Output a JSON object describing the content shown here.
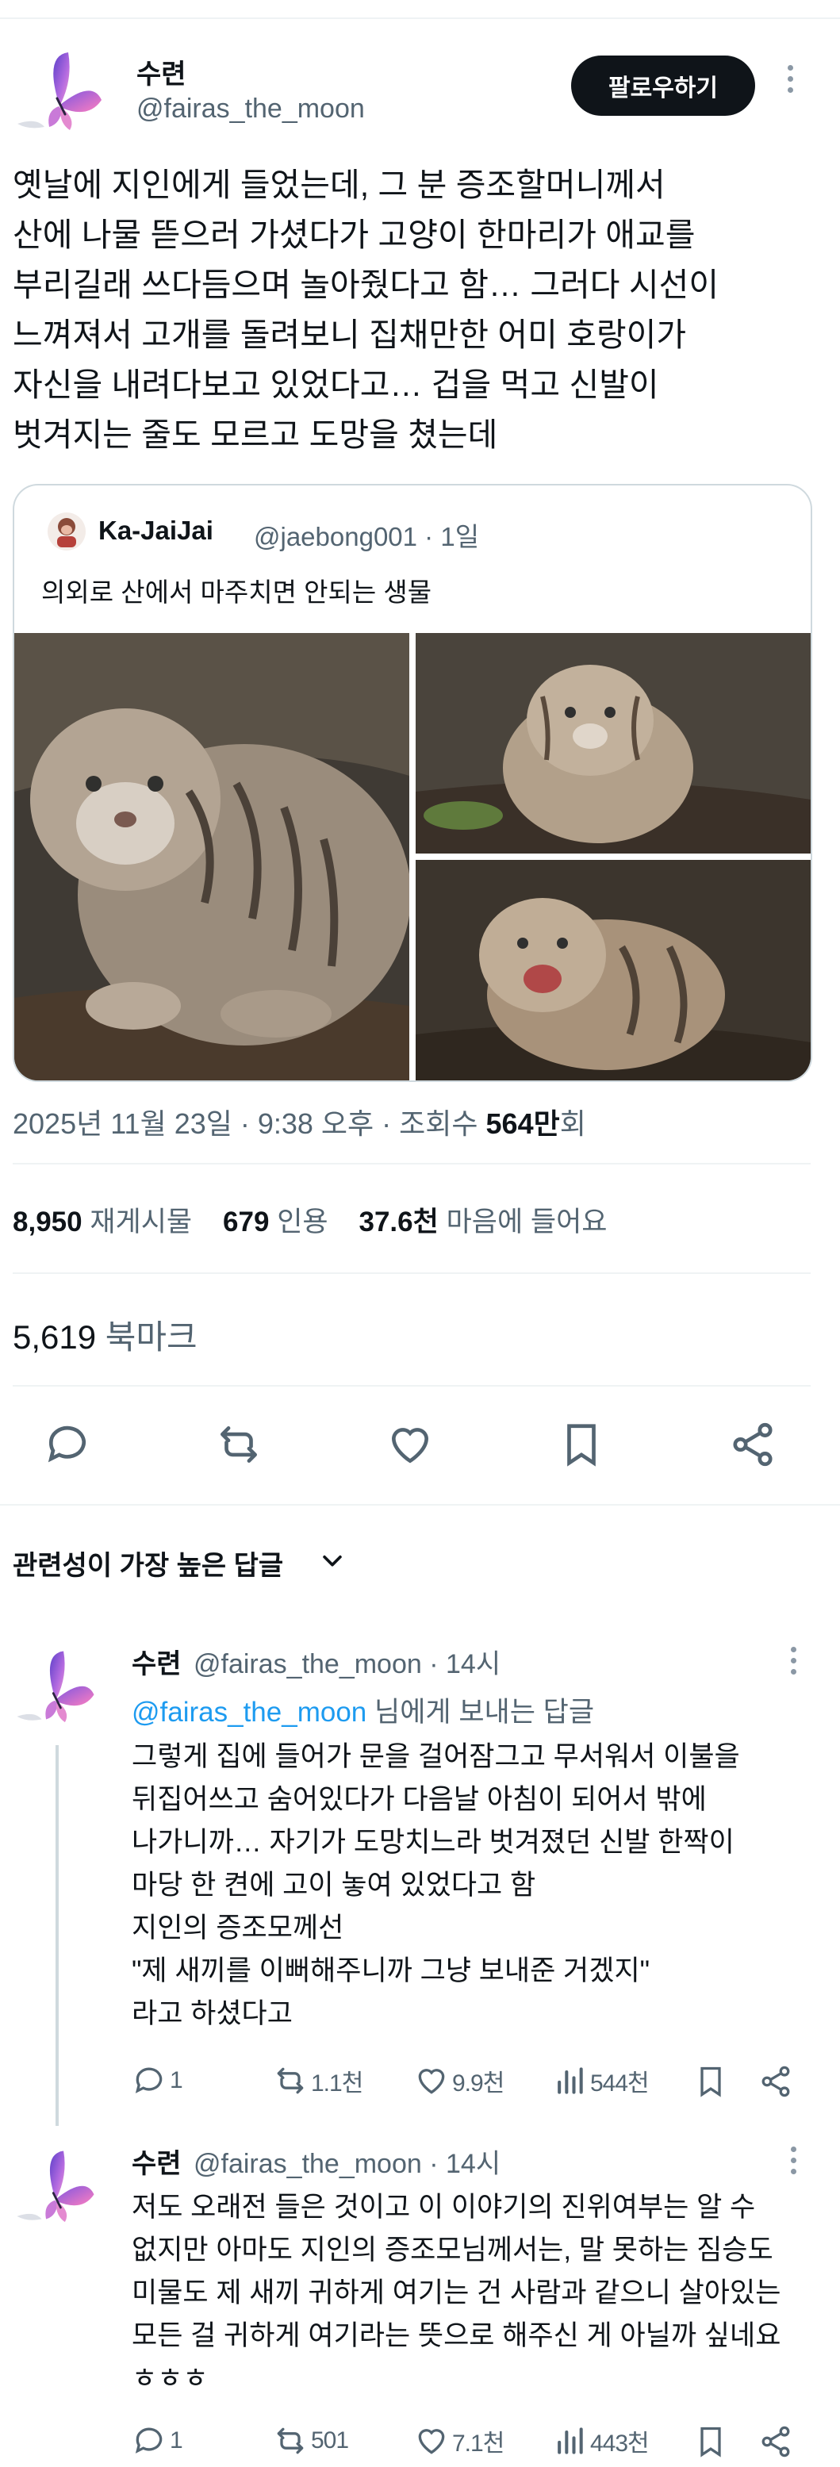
{
  "main_tweet": {
    "author_name": "수련",
    "author_handle": "@fairas_the_moon",
    "follow_label": "팔로우하기",
    "text": "옛날에 지인에게 들었는데, 그 분 증조할머니께서\n산에 나물 뜯으러 가셨다가 고양이 한마리가 애교를\n부리길래 쓰다듬으며 놀아줬다고 함… 그러다 시선이\n느껴져서 고개를 돌려보니 집채만한 어미 호랑이가\n자신을 내려다보고 있었다고… 겁을 먹고 신발이\n벗겨지는 줄도 모르고 도망을 쳤는데",
    "quote": {
      "author_name": "Ka-JaiJai",
      "meta": "@jaebong001 · 1일",
      "text": "의외로 산에서 마주치면 안되는 생물"
    },
    "timestamp": "2025년 11월 23일 · 9:38 오후 · 조회수 ",
    "views": "564만",
    "views_suffix": "회",
    "stats": {
      "retweets": "8,950",
      "retweets_label": "재게시물",
      "quotes": "679",
      "quotes_label": "인용",
      "likes": "37.6천",
      "likes_label": "마음에 들어요"
    },
    "bookmarks": "5,619",
    "bookmarks_label": "북마크"
  },
  "sort_label": "관련성이 가장 높은 답글",
  "replies": [
    {
      "author_name": "수련",
      "meta": "@fairas_the_moon · 14시",
      "replying_mention": "@fairas_the_moon",
      "replying_suffix": " 님에게 보내는 답글",
      "text": "그렇게 집에 들어가 문을 걸어잠그고 무서워서 이불을\n뒤집어쓰고 숨어있다가 다음날 아침이 되어서 밖에\n나가니까… 자기가 도망치느라 벗겨졌던 신발 한짝이\n마당 한 켠에 고이 놓여 있었다고 함\n지인의 증조모께선\n\"제 새끼를 이뻐해주니까 그냥 보내준 거겠지\"\n라고 하셨다고",
      "replies": "1",
      "retweets": "1.1천",
      "likes": "9.9천",
      "views": "544천"
    },
    {
      "author_name": "수련",
      "meta": "@fairas_the_moon · 14시",
      "text": "저도 오래전 들은 것이고 이 이야기의 진위여부는 알 수\n없지만 아마도 지인의 증조모님께서는, 말 못하는 짐승도\n미물도 제 새끼 귀하게 여기는 건 사람과 같으니 살아있는\n모든 걸 귀하게 여기라는 뜻으로 해주신 게 아닐까 싶네요\nㅎㅎㅎ",
      "replies": "1",
      "retweets": "501",
      "likes": "7.1천",
      "views": "443천"
    }
  ],
  "colors": {
    "text": "#0f1419",
    "secondary": "#536471",
    "link": "#1d9bf0",
    "border": "#cfd9de"
  },
  "icons": [
    "butterfly-avatar",
    "monkey-avatar",
    "reply-icon",
    "retweet-icon",
    "like-icon",
    "bookmark-icon",
    "share-icon",
    "views-icon",
    "more-icon",
    "chevron-down-icon"
  ]
}
